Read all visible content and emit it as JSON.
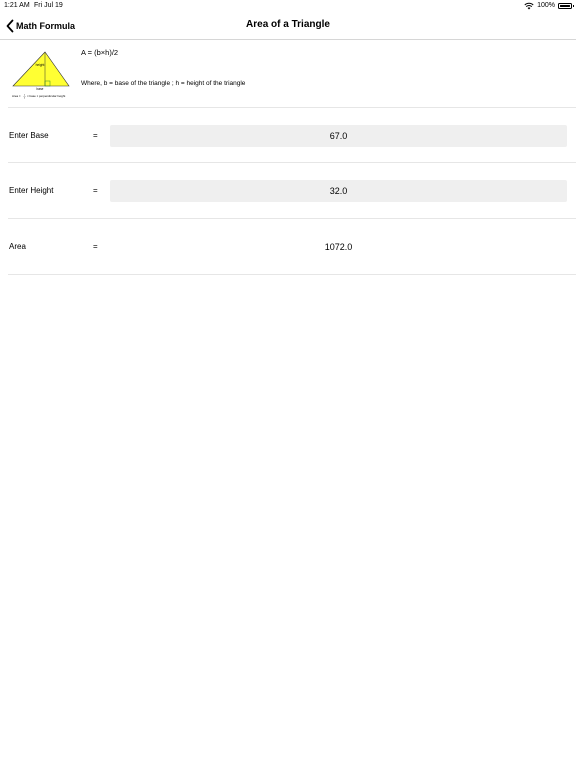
{
  "status_bar": {
    "time": "1:21 AM",
    "date": "Fri Jul 19",
    "battery": "100%"
  },
  "nav": {
    "back_label": "Math Formula",
    "title": "Area of a Triangle"
  },
  "figure": {
    "height_label": "height",
    "base_label": "base",
    "caption_prefix": "Area =",
    "caption_fraction_top": "1",
    "caption_fraction_bottom": "2",
    "caption_suffix": "× base × perpendicular height"
  },
  "formula": {
    "equation": "A = (b×h)/2",
    "explanation": "Where, b = base of the triangle ; h = height of the triangle"
  },
  "rows": [
    {
      "label": "Enter Base",
      "eq": "=",
      "value": "67.0"
    },
    {
      "label": "Enter Height",
      "eq": "=",
      "value": "32.0"
    },
    {
      "label": "Area",
      "eq": "=",
      "value": "1072.0"
    }
  ],
  "colors": {
    "triangle_fill": "#ffff33",
    "field_bg": "#efefef",
    "divider": "#e6e6e6"
  }
}
